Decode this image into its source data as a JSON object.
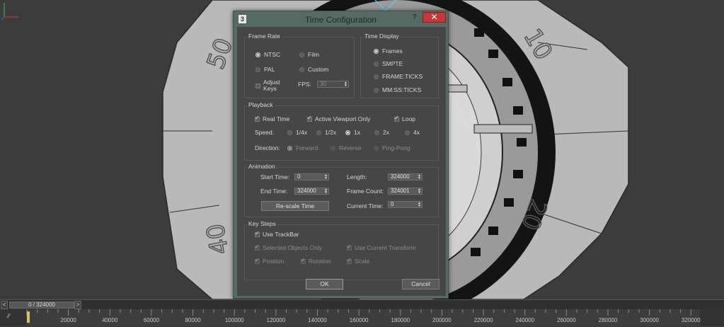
{
  "dialog": {
    "title": "Time Configuration",
    "app_icon": "3",
    "help": "?",
    "close": "✕",
    "frame_rate": {
      "title": "Frame Rate",
      "options": [
        "NTSC",
        "Film",
        "PAL",
        "Custom"
      ],
      "selected": "NTSC",
      "adjust_keys": "Adjust Keys",
      "fps_label": "FPS:",
      "fps_value": "30"
    },
    "time_display": {
      "title": "Time Display",
      "options": [
        "Frames",
        "SMPTE",
        "FRAME:TICKS",
        "MM:SS:TICKS"
      ],
      "selected": "Frames"
    },
    "playback": {
      "title": "Playback",
      "real_time": "Real Time",
      "active_viewport": "Active Viewport Only",
      "loop": "Loop",
      "speed_label": "Speed:",
      "speeds": [
        "1/4x",
        "1/2x",
        "1x",
        "2x",
        "4x"
      ],
      "speed_selected": "1x",
      "direction_label": "Direction:",
      "directions": [
        "Forward",
        "Reverse",
        "Ping-Pong"
      ]
    },
    "animation": {
      "title": "Animation",
      "start_time_label": "Start Time:",
      "start_time": "0",
      "end_time_label": "End Time:",
      "end_time": "324000",
      "length_label": "Length:",
      "length": "324000",
      "frame_count_label": "Frame Count:",
      "frame_count": "324001",
      "current_time_label": "Current Time:",
      "current_time": "0",
      "rescale": "Re-scale Time"
    },
    "key_steps": {
      "title": "Key Steps",
      "use_trackbar": "Use TrackBar",
      "selected_only": "Selected Objects Only",
      "use_current_transform": "Use Current Transform",
      "position": "Position",
      "rotation": "Rotation",
      "scale": "Scale"
    },
    "ok": "OK",
    "cancel": "Cancel"
  },
  "timeline": {
    "slider_value": "0 / 324000",
    "prev": "<",
    "next": ">",
    "ticks": [
      "20000",
      "40000",
      "60000",
      "80000",
      "100000",
      "120000",
      "140000",
      "160000",
      "180000",
      "200000",
      "220000",
      "240000",
      "260000",
      "280000",
      "300000",
      "320000"
    ]
  },
  "viewport": {
    "dial_numbers": [
      "50",
      "10",
      "20",
      "40"
    ]
  },
  "colors": {
    "dialog_frame": "#556a62",
    "close_button": "#c73737",
    "client_bg": "#464646"
  }
}
